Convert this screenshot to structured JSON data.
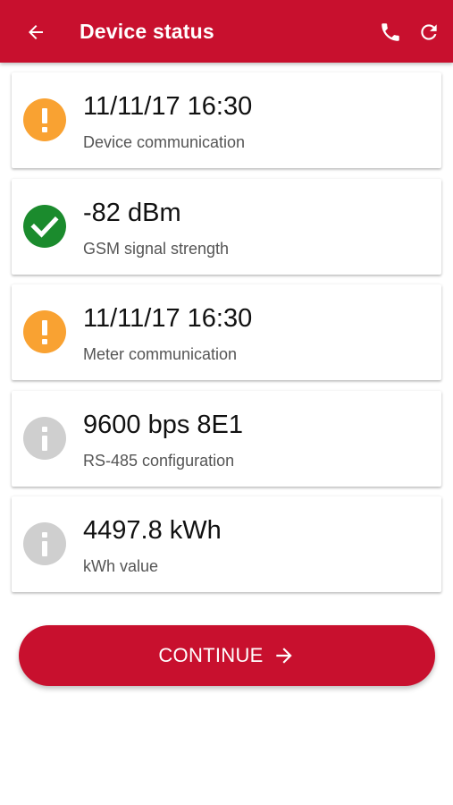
{
  "header": {
    "title": "Device status",
    "back_icon": "arrow-left-icon",
    "phone_icon": "phone-icon",
    "refresh_icon": "refresh-icon",
    "background_color": "#c8102e"
  },
  "status_items": [
    {
      "value": "11/11/17 16:30",
      "label": "Device communication",
      "status": "warning",
      "icon": "exclamation-icon",
      "icon_color": "#f9a232"
    },
    {
      "value": "-82 dBm",
      "label": "GSM signal strength",
      "status": "ok",
      "icon": "checkmark-icon",
      "icon_color": "#1b8b2d"
    },
    {
      "value": "11/11/17 16:30",
      "label": "Meter communication",
      "status": "warning",
      "icon": "exclamation-icon",
      "icon_color": "#f9a232"
    },
    {
      "value": "9600 bps 8E1",
      "label": "RS-485 configuration",
      "status": "info",
      "icon": "info-icon",
      "icon_color": "#cfcfcf"
    },
    {
      "value": "4497.8 kWh",
      "label": "kWh value",
      "status": "info",
      "icon": "info-icon",
      "icon_color": "#cfcfcf"
    }
  ],
  "continue_button": {
    "label": "CONTINUE",
    "icon": "arrow-right-icon"
  }
}
